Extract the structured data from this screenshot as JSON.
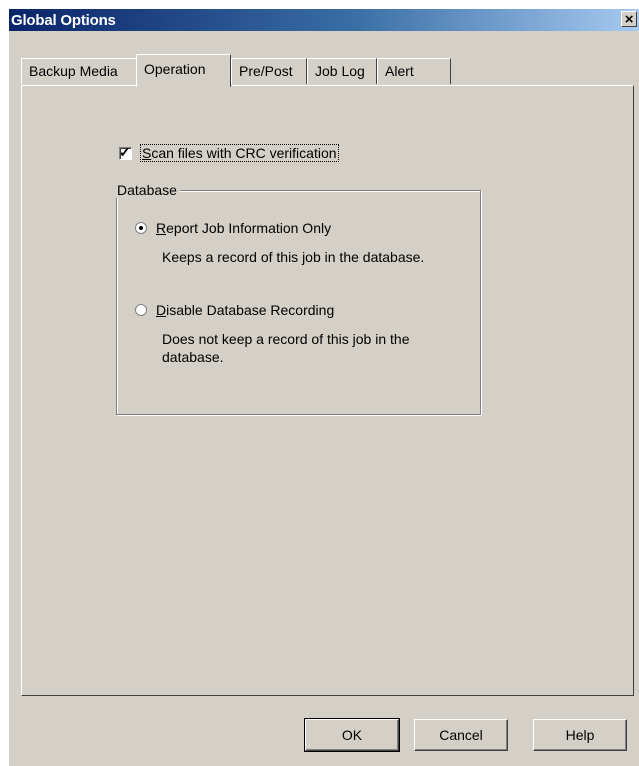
{
  "window": {
    "title": "Global Options",
    "close_glyph": "×"
  },
  "tabs": [
    {
      "label": "Backup Media",
      "active": false
    },
    {
      "label": "Operation",
      "active": true
    },
    {
      "label": "Pre/Post",
      "active": false
    },
    {
      "label": "Job Log",
      "active": false
    },
    {
      "label": "Alert",
      "active": false
    }
  ],
  "operation": {
    "crc_checkbox": {
      "label_first": "S",
      "label_rest": "can files with CRC verification",
      "checked": true
    },
    "database_group": {
      "legend": "Database",
      "options": [
        {
          "label_first": "R",
          "label_rest": "eport Job Information Only",
          "selected": true,
          "description": "Keeps a record of this job in the database."
        },
        {
          "label_first": "D",
          "label_rest": "isable Database Recording",
          "selected": false,
          "description": "Does not keep a record of this job in the database."
        }
      ]
    }
  },
  "buttons": {
    "ok": "OK",
    "cancel": "Cancel",
    "help": "Help"
  }
}
